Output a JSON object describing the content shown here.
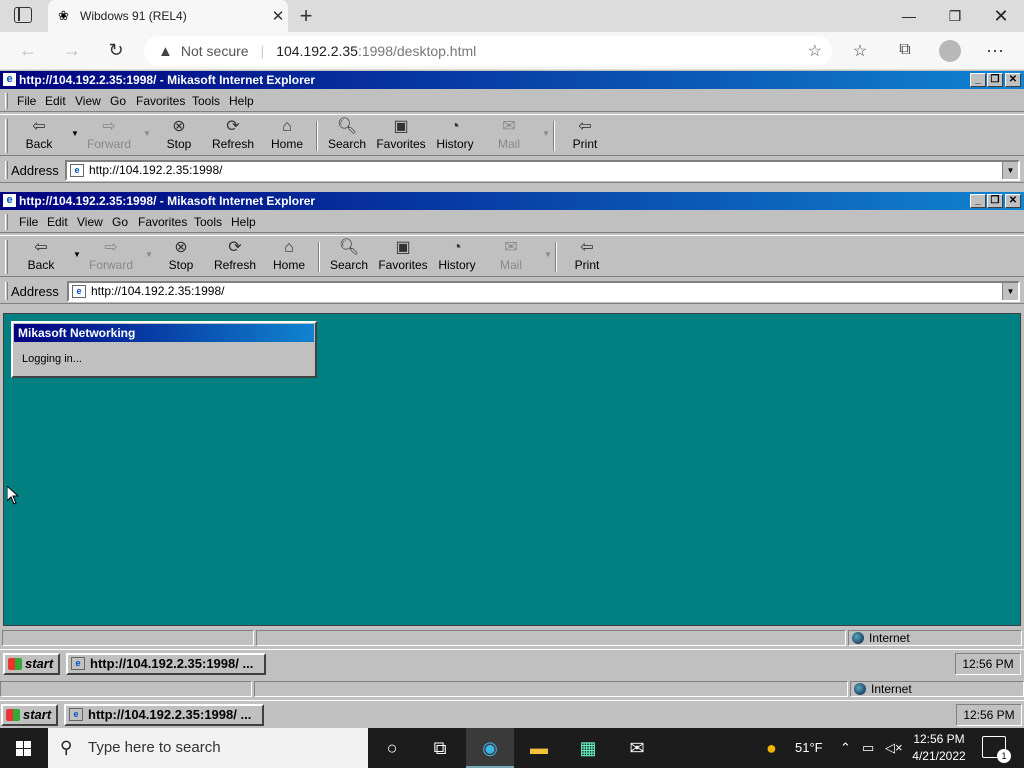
{
  "edge": {
    "tab_title": "Wibdows 91 (REL4)",
    "not_secure": "Not secure",
    "url_host": "104.192.2.35",
    "url_path": ":1998/desktop.html"
  },
  "ie_outer": {
    "title": "http://104.192.2.35:1998/ - Mikasoft Internet Explorer",
    "address": "http://104.192.2.35:1998/"
  },
  "ie_inner": {
    "title": "http://104.192.2.35:1998/ - Mikasoft Internet Explorer",
    "address": "http://104.192.2.35:1998/"
  },
  "menu": [
    "File",
    "Edit",
    "View",
    "Go",
    "Favorites",
    "Tools",
    "Help"
  ],
  "toolbar": {
    "back": "Back",
    "forward": "Forward",
    "stop": "Stop",
    "refresh": "Refresh",
    "home": "Home",
    "search": "Search",
    "favorites": "Favorites",
    "history": "History",
    "mail": "Mail",
    "print": "Print"
  },
  "address_label": "Address",
  "dialog": {
    "title": "Mikasoft Networking",
    "message": "Logging in..."
  },
  "status": {
    "zone": "Internet"
  },
  "taskbar98": {
    "start": "start",
    "task": "http://104.192.2.35:1998/ ...",
    "clock": "12:56 PM"
  },
  "win10": {
    "search_placeholder": "Type here to search",
    "weather": "51°F",
    "time": "12:56 PM",
    "date": "4/21/2022",
    "notifications": "1"
  }
}
